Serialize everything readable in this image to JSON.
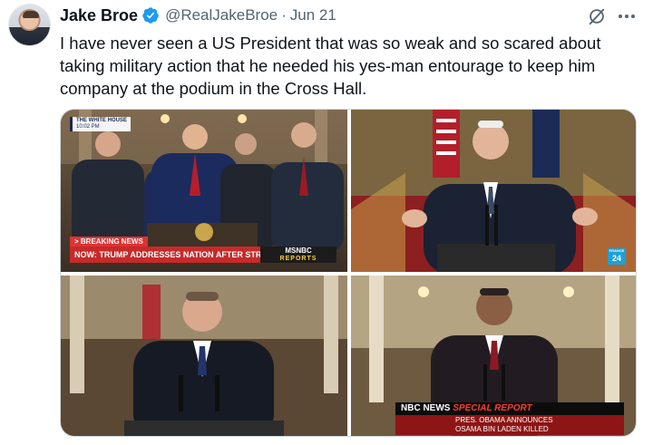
{
  "author": {
    "display_name": "Jake Broe",
    "handle": "@RealJakeBroe",
    "separator": "·",
    "date": "Jun 21",
    "verified_icon": "verified-badge-icon",
    "verified_color": "#1d9bf0"
  },
  "header_actions": {
    "grok_icon": "grok-icon",
    "more_icon": "more-options-icon"
  },
  "tweet": {
    "text": "I have never seen a US President that was so weak and so scared about taking military action that he needed his yes-man entourage to keep him company at the podium in the Cross Hall."
  },
  "media": {
    "image1": {
      "bug_line1": "THE WHITE HOUSE",
      "bug_line2": "10:02 PM",
      "breaking_label": "> BREAKING NEWS",
      "headline": "NOW: TRUMP ADDRESSES NATION AFTER STRIKES ON IRAN",
      "network": "MSNBC",
      "network_sub": "REPORTS"
    },
    "image2": {
      "logo_line1": "FRANCE",
      "logo_line2": "24"
    },
    "image3": {},
    "image4": {
      "network": "NBC NEWS",
      "banner": "SPECIAL REPORT",
      "sub_line1": "PRES. OBAMA ANNOUNCES",
      "sub_line2": "OSAMA BIN LADEN KILLED"
    }
  },
  "colors": {
    "text_primary": "#0f1419",
    "text_secondary": "#536471",
    "border": "#cfd9de",
    "breaking_red": "#c62a2a",
    "nbc_red": "#8e1515"
  }
}
